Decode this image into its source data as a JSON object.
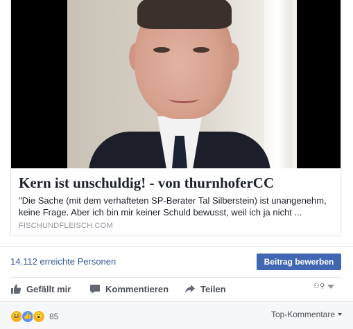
{
  "link_preview": {
    "title": "Kern ist unschuldig! - von thurnhoferCC",
    "description": "\"Die Sache (mit dem verhafteten SP-Berater Tal Silberstein) ist unangenehm, keine Frage. Aber ich bin mir keiner Schuld bewusst, weil ich ja nicht ...",
    "domain": "FISCHUNDFLEISCH.COM"
  },
  "insights": {
    "reach_text": "14.112 erreichte Personen",
    "promote_label": "Beitrag bewerben"
  },
  "actions": {
    "like_label": "Gefällt mir",
    "comment_label": "Kommentieren",
    "share_label": "Teilen"
  },
  "reactions": {
    "icons": [
      "haha-emoji",
      "like-emoji",
      "wow-emoji"
    ],
    "count": "85"
  },
  "comments": {
    "sort_label": "Top-Kommentare"
  },
  "colors": {
    "link_blue": "#365899",
    "button_blue": "#4267b2",
    "footer_bg": "#f6f7f9"
  }
}
